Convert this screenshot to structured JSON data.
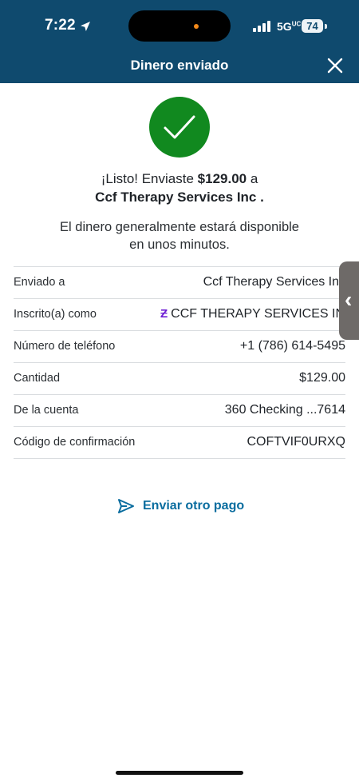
{
  "status_bar": {
    "time": "7:22",
    "network": "5G",
    "network_sup": "UC",
    "battery": "74"
  },
  "header": {
    "title": "Dinero enviado"
  },
  "confirmation": {
    "prefix": "¡Listo! Enviaste ",
    "amount": "$129.00",
    "connector": " a",
    "recipient_line": "Ccf Therapy Services Inc .",
    "availability_line1": "El dinero generalmente estará disponible",
    "availability_line2": "en unos minutos."
  },
  "details": [
    {
      "label": "Enviado a",
      "value": "Ccf Therapy Services Inc"
    },
    {
      "label": "Inscrito(a) como",
      "value": "CCF THERAPY SERVICES INC"
    },
    {
      "label": "Número de teléfono",
      "value": "+1 (786) 614-5495"
    },
    {
      "label": "Cantidad",
      "value": "$129.00"
    },
    {
      "label": "De la cuenta",
      "value": "360 Checking ...7614"
    },
    {
      "label": "Código de confirmación",
      "value": "COFTVIF0URXQ"
    }
  ],
  "actions": {
    "send_another": "Enviar otro pago"
  },
  "colors": {
    "header_bg": "#0f4a6e",
    "success_green": "#11891f",
    "link_blue": "#0a6d9f",
    "zelle_purple": "#6d1ed4"
  },
  "icons": [
    "location-arrow-icon",
    "signal-icon",
    "close-icon",
    "checkmark-icon",
    "zelle-icon",
    "chevron-left-icon",
    "send-icon"
  ]
}
